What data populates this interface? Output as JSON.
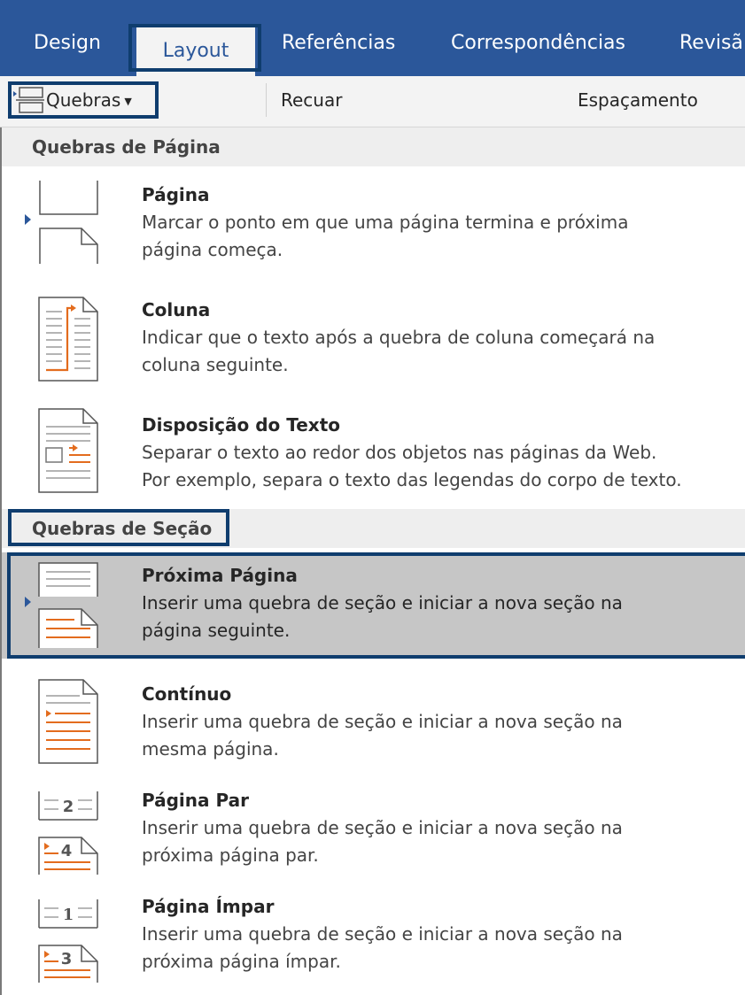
{
  "tabs": [
    {
      "label": "Design"
    },
    {
      "label": "Layout"
    },
    {
      "label": "Referências"
    },
    {
      "label": "Correspondências"
    },
    {
      "label": "Revisã"
    }
  ],
  "ribbon": {
    "breaks_label": "Quebras",
    "indent_label": "Recuar",
    "spacing_label": "Espaçamento"
  },
  "sections": {
    "page_breaks": "Quebras de Página",
    "section_breaks": "Quebras de Seção"
  },
  "items": [
    {
      "title": "Página",
      "access_key": "P",
      "desc_lines": [
        "Marcar o ponto em que uma página termina e próxima",
        "página começa."
      ]
    },
    {
      "title": "Coluna",
      "access_key": "C",
      "desc_lines": [
        "Indicar que o texto após a quebra de coluna começará na",
        "coluna seguinte."
      ]
    },
    {
      "title": "Disposição do Texto",
      "access_key": "D",
      "desc_lines": [
        "Separar o texto ao redor dos objetos nas páginas da Web.",
        "Por exemplo, separa o texto das legendas do corpo de texto."
      ]
    },
    {
      "title": "Próxima Página",
      "access_key": "x",
      "desc_lines": [
        "Inserir uma quebra de seção e iniciar a nova seção na",
        "página seguinte."
      ]
    },
    {
      "title": "Contínuo",
      "access_key": "n",
      "desc_lines": [
        "Inserir uma quebra de seção e iniciar a nova seção na",
        "mesma página."
      ]
    },
    {
      "title": "Página Par",
      "access_key": "n",
      "desc_lines": [
        "Inserir uma quebra de seção e iniciar a nova seção na",
        "próxima página par."
      ]
    },
    {
      "title": "Página Ímpar",
      "access_key": "a",
      "desc_lines": [
        "Inserir uma quebra de seção e iniciar a nova seção na",
        "próxima página ímpar."
      ]
    }
  ],
  "icon_labels": {
    "even_top": "2",
    "even_bottom": "4",
    "odd_top": "1",
    "odd_bottom": "3"
  },
  "colors": {
    "ribbon_blue": "#2b579a",
    "highlight_border": "#0f3d6e",
    "icon_accent": "#e36c1e",
    "selected_bg": "#c6c6c6"
  }
}
